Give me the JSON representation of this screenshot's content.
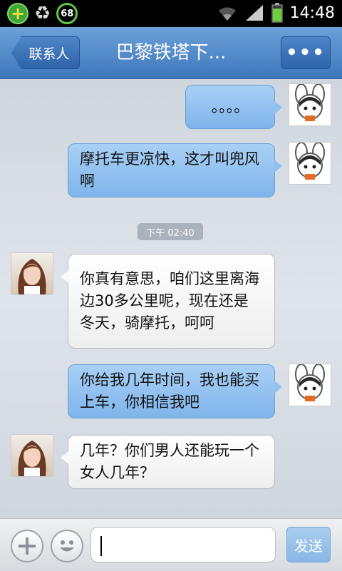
{
  "status_bar": {
    "battery_ring_value": "68",
    "time": "14:48"
  },
  "header": {
    "back_label": "联系人",
    "title": "巴黎铁塔下...",
    "more_label": "•••"
  },
  "messages": [
    {
      "side": "me",
      "text": "。。。。"
    },
    {
      "side": "me",
      "text": "摩托车更凉快，这才叫兜风啊"
    },
    {
      "side": "other",
      "text": "你真有意思，咱们这里离海边30多公里呢，现在还是冬天，骑摩托，呵呵"
    },
    {
      "side": "me",
      "text": "你给我几年时间，我也能买上车，你相信我吧"
    },
    {
      "side": "other",
      "text": "几年？你们男人还能玩一个女人几年？"
    }
  ],
  "timestamp": "下午 02:40",
  "input_bar": {
    "input_value": "",
    "send_label": "发送"
  },
  "colors": {
    "header_blue": "#3f77bd",
    "my_bubble": "#8fc0ef",
    "other_bubble": "#ffffff",
    "send_button": "#9cc4ec"
  }
}
